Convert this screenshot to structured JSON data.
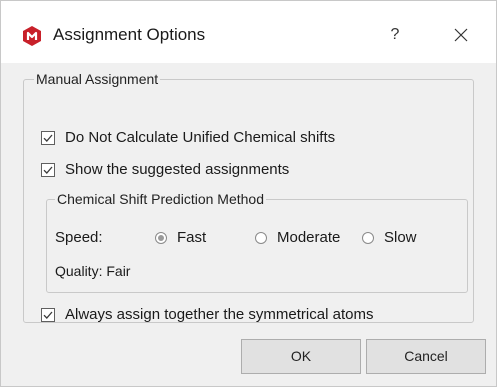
{
  "window": {
    "title": "Assignment Options",
    "help_label": "?",
    "app_icon": "mnova-logo-icon",
    "accent_color": "#c8202a"
  },
  "manual_assignment": {
    "legend": "Manual Assignment",
    "do_not_calculate": {
      "label": "Do Not Calculate Unified Chemical shifts",
      "checked": true
    },
    "show_suggested": {
      "label": "Show the suggested assignments",
      "checked": true
    },
    "prediction": {
      "legend": "Chemical Shift Prediction Method",
      "speed_label": "Speed:",
      "speed_options": [
        "Fast",
        "Moderate",
        "Slow"
      ],
      "speed_selected": "Fast",
      "quality_text": "Quality: Fair"
    },
    "symmetrical": {
      "label": "Always assign together the symmetrical atoms",
      "checked": true
    }
  },
  "buttons": {
    "ok": "OK",
    "cancel": "Cancel"
  }
}
